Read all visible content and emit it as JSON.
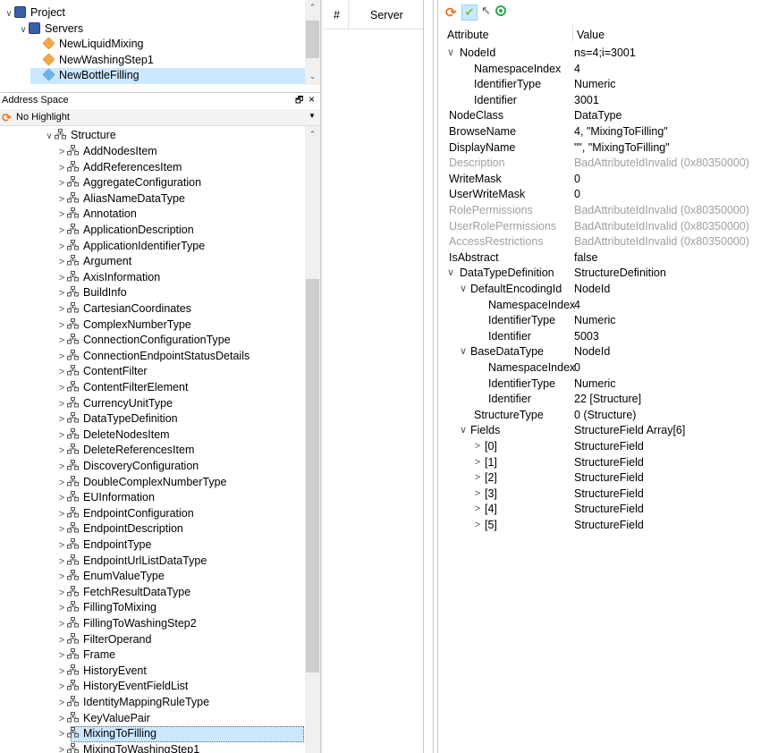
{
  "project_tree": {
    "items": [
      {
        "label": "Project",
        "indent": 0,
        "chev": "∨",
        "icon": "book"
      },
      {
        "label": "Servers",
        "indent": 1,
        "chev": "∨",
        "icon": "book"
      },
      {
        "label": "NewLiquidMixing",
        "indent": 2,
        "chev": "",
        "icon": "server"
      },
      {
        "label": "NewWashingStep1",
        "indent": 2,
        "chev": "",
        "icon": "server"
      },
      {
        "label": "NewBottleFilling",
        "indent": 2,
        "chev": "",
        "icon": "server-active",
        "selected": true
      }
    ]
  },
  "address_space": {
    "title": "Address Space",
    "pin": "🗗",
    "close": "×",
    "highlight_value": "No Highlight",
    "root": {
      "label": "Structure",
      "chev": "∨"
    },
    "items": [
      "AddNodesItem",
      "AddReferencesItem",
      "AggregateConfiguration",
      "AliasNameDataType",
      "Annotation",
      "ApplicationDescription",
      "ApplicationIdentifierType",
      "Argument",
      "AxisInformation",
      "BuildInfo",
      "CartesianCoordinates",
      "ComplexNumberType",
      "ConnectionConfigurationType",
      "ConnectionEndpointStatusDetails",
      "ContentFilter",
      "ContentFilterElement",
      "CurrencyUnitType",
      "DataTypeDefinition",
      "DeleteNodesItem",
      "DeleteReferencesItem",
      "DiscoveryConfiguration",
      "DoubleComplexNumberType",
      "EUInformation",
      "EndpointConfiguration",
      "EndpointDescription",
      "EndpointType",
      "EndpointUrlListDataType",
      "EnumValueType",
      "FetchResultDataType",
      "FillingToMixing",
      "FillingToWashingStep2",
      "FilterOperand",
      "Frame",
      "HistoryEvent",
      "HistoryEventFieldList",
      "IdentityMappingRuleType",
      "KeyValuePair",
      "MixingToFilling",
      "MixingToWashingStep1"
    ],
    "selected": "MixingToFilling"
  },
  "server_panel": {
    "col_hash": "#",
    "col_server": "Server"
  },
  "attributes": {
    "header": {
      "attr": "Attribute",
      "value": "Value"
    },
    "rows": [
      {
        "a": "NodeId",
        "v": "ns=4;i=3001",
        "lvl": 0,
        "exp": "∨"
      },
      {
        "a": "NamespaceIndex",
        "v": "4",
        "lvl": 1
      },
      {
        "a": "IdentifierType",
        "v": "Numeric",
        "lvl": 1
      },
      {
        "a": "Identifier",
        "v": "3001",
        "lvl": 1
      },
      {
        "a": "NodeClass",
        "v": "DataType",
        "lvl": 0
      },
      {
        "a": "BrowseName",
        "v": "4, \"MixingToFilling\"",
        "lvl": 0
      },
      {
        "a": "DisplayName",
        "v": "\"\", \"MixingToFilling\"",
        "lvl": 0
      },
      {
        "a": "Description",
        "v": "BadAttributeIdInvalid (0x80350000)",
        "lvl": 0,
        "dim": true
      },
      {
        "a": "WriteMask",
        "v": "0",
        "lvl": 0
      },
      {
        "a": "UserWriteMask",
        "v": "0",
        "lvl": 0
      },
      {
        "a": "RolePermissions",
        "v": "BadAttributeIdInvalid (0x80350000)",
        "lvl": 0,
        "dim": true
      },
      {
        "a": "UserRolePermissions",
        "v": "BadAttributeIdInvalid (0x80350000)",
        "lvl": 0,
        "dim": true
      },
      {
        "a": "AccessRestrictions",
        "v": "BadAttributeIdInvalid (0x80350000)",
        "lvl": 0,
        "dim": true
      },
      {
        "a": "IsAbstract",
        "v": "false",
        "lvl": 0
      },
      {
        "a": "DataTypeDefinition",
        "v": "StructureDefinition",
        "lvl": 0,
        "exp": "∨"
      },
      {
        "a": "DefaultEncodingId",
        "v": "NodeId",
        "lvl": 1,
        "exp": "∨"
      },
      {
        "a": "NamespaceIndex",
        "v": "4",
        "lvl": 2
      },
      {
        "a": "IdentifierType",
        "v": "Numeric",
        "lvl": 2
      },
      {
        "a": "Identifier",
        "v": "5003",
        "lvl": 2
      },
      {
        "a": "BaseDataType",
        "v": "NodeId",
        "lvl": 1,
        "exp": "∨"
      },
      {
        "a": "NamespaceIndex",
        "v": "0",
        "lvl": 2
      },
      {
        "a": "IdentifierType",
        "v": "Numeric",
        "lvl": 2
      },
      {
        "a": "Identifier",
        "v": "22 [Structure]",
        "lvl": 2
      },
      {
        "a": "StructureType",
        "v": "0 (Structure)",
        "lvl": 1
      },
      {
        "a": "Fields",
        "v": "StructureField Array[6]",
        "lvl": 1,
        "exp": "∨"
      },
      {
        "a": "[0]",
        "v": "StructureField",
        "lvl": 2,
        "exp": ">"
      },
      {
        "a": "[1]",
        "v": "StructureField",
        "lvl": 2,
        "exp": ">"
      },
      {
        "a": "[2]",
        "v": "StructureField",
        "lvl": 2,
        "exp": ">"
      },
      {
        "a": "[3]",
        "v": "StructureField",
        "lvl": 2,
        "exp": ">"
      },
      {
        "a": "[4]",
        "v": "StructureField",
        "lvl": 2,
        "exp": ">"
      },
      {
        "a": "[5]",
        "v": "StructureField",
        "lvl": 2,
        "exp": ">"
      }
    ]
  },
  "colors": {
    "selection": "#cce8ff",
    "selection_border": "#99d1ff",
    "dim_text": "#a0a0a0",
    "refresh": "#e8711a",
    "check": "#7cc142",
    "target": "#2ea84a"
  }
}
